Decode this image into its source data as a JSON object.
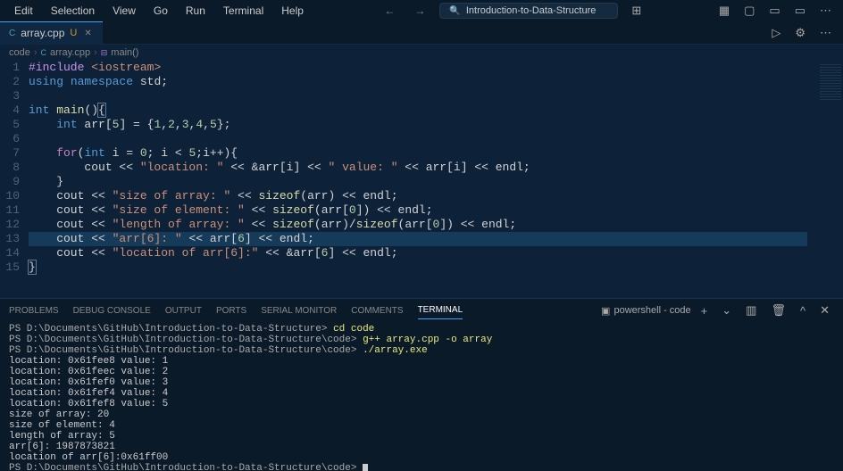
{
  "menu": {
    "edit": "Edit",
    "selection": "Selection",
    "view": "View",
    "go": "Go",
    "run": "Run",
    "terminal": "Terminal",
    "help": "Help"
  },
  "search": {
    "label": "Introduction-to-Data-Structure"
  },
  "tab": {
    "filename": "array.cpp",
    "status": "U"
  },
  "breadcrumb": {
    "p0": "code",
    "p1": "array.cpp",
    "p2": "main()"
  },
  "code": {
    "lines": [
      [
        {
          "c": "kw-inc",
          "t": "#include"
        },
        {
          "c": "",
          "t": " "
        },
        {
          "c": "str",
          "t": "<iostream>"
        }
      ],
      [
        {
          "c": "kw-using",
          "t": "using"
        },
        {
          "c": "",
          "t": " "
        },
        {
          "c": "kw",
          "t": "namespace"
        },
        {
          "c": "",
          "t": " std;"
        }
      ],
      [],
      [
        {
          "c": "kw-type",
          "t": "int"
        },
        {
          "c": "",
          "t": " "
        },
        {
          "c": "func",
          "t": "main"
        },
        {
          "c": "",
          "t": "()"
        },
        {
          "c": "brace-hl",
          "t": "{"
        }
      ],
      [
        {
          "c": "",
          "t": "    "
        },
        {
          "c": "kw-type",
          "t": "int"
        },
        {
          "c": "",
          "t": " arr["
        },
        {
          "c": "num",
          "t": "5"
        },
        {
          "c": "",
          "t": "] = {"
        },
        {
          "c": "num",
          "t": "1"
        },
        {
          "c": "",
          "t": ","
        },
        {
          "c": "num",
          "t": "2"
        },
        {
          "c": "",
          "t": ","
        },
        {
          "c": "num",
          "t": "3"
        },
        {
          "c": "",
          "t": ","
        },
        {
          "c": "num",
          "t": "4"
        },
        {
          "c": "",
          "t": ","
        },
        {
          "c": "num",
          "t": "5"
        },
        {
          "c": "",
          "t": "};"
        }
      ],
      [],
      [
        {
          "c": "",
          "t": "    "
        },
        {
          "c": "kw-for",
          "t": "for"
        },
        {
          "c": "",
          "t": "("
        },
        {
          "c": "kw-type",
          "t": "int"
        },
        {
          "c": "",
          "t": " i = "
        },
        {
          "c": "num",
          "t": "0"
        },
        {
          "c": "",
          "t": "; i < "
        },
        {
          "c": "num",
          "t": "5"
        },
        {
          "c": "",
          "t": ";i++){"
        }
      ],
      [
        {
          "c": "",
          "t": "        cout << "
        },
        {
          "c": "str",
          "t": "\"location: \""
        },
        {
          "c": "",
          "t": " << &arr[i] << "
        },
        {
          "c": "str",
          "t": "\" value: \""
        },
        {
          "c": "",
          "t": " << arr[i] << endl;"
        }
      ],
      [
        {
          "c": "",
          "t": "    }"
        }
      ],
      [
        {
          "c": "",
          "t": "    cout << "
        },
        {
          "c": "str",
          "t": "\"size of array: \""
        },
        {
          "c": "",
          "t": " << "
        },
        {
          "c": "func",
          "t": "sizeof"
        },
        {
          "c": "",
          "t": "(arr) << endl;"
        }
      ],
      [
        {
          "c": "",
          "t": "    cout << "
        },
        {
          "c": "str",
          "t": "\"size of element: \""
        },
        {
          "c": "",
          "t": " << "
        },
        {
          "c": "func",
          "t": "sizeof"
        },
        {
          "c": "",
          "t": "(arr["
        },
        {
          "c": "num",
          "t": "0"
        },
        {
          "c": "",
          "t": "]) << endl;"
        }
      ],
      [
        {
          "c": "",
          "t": "    cout << "
        },
        {
          "c": "str",
          "t": "\"length of array: \""
        },
        {
          "c": "",
          "t": " << "
        },
        {
          "c": "func",
          "t": "sizeof"
        },
        {
          "c": "",
          "t": "(arr)/"
        },
        {
          "c": "func",
          "t": "sizeof"
        },
        {
          "c": "",
          "t": "(arr["
        },
        {
          "c": "num",
          "t": "0"
        },
        {
          "c": "",
          "t": "]) << endl;"
        }
      ],
      [
        {
          "c": "",
          "t": "    cout << "
        },
        {
          "c": "str",
          "t": "\"arr[6]: \""
        },
        {
          "c": "",
          "t": " << arr["
        },
        {
          "c": "num",
          "t": "6"
        },
        {
          "c": "",
          "t": "] << endl;"
        }
      ],
      [
        {
          "c": "",
          "t": "    cout << "
        },
        {
          "c": "str",
          "t": "\"location of arr[6]:\""
        },
        {
          "c": "",
          "t": " << &arr["
        },
        {
          "c": "num",
          "t": "6"
        },
        {
          "c": "",
          "t": "] << endl;"
        }
      ],
      [
        {
          "c": "brace-hl",
          "t": "}"
        }
      ]
    ],
    "highlight_line": 13
  },
  "panel": {
    "tabs": {
      "problems": "PROBLEMS",
      "debug": "DEBUG CONSOLE",
      "output": "OUTPUT",
      "ports": "PORTS",
      "serial": "SERIAL MONITOR",
      "comments": "COMMENTS",
      "terminal": "TERMINAL"
    },
    "shell": "powershell - code"
  },
  "terminal": {
    "prompt": "PS D:\\Documents\\GitHub\\Introduction-to-Data-Structure",
    "prompt_code": "PS D:\\Documents\\GitHub\\Introduction-to-Data-Structure\\code>",
    "cmd1": "cd code",
    "cmd2": "g++ array.cpp -o array",
    "cmd3": "./array.exe",
    "out1": "location: 0x61fee8 value: 1",
    "out2": "location: 0x61feec value: 2",
    "out3": "location: 0x61fef0 value: 3",
    "out4": "location: 0x61fef4 value: 4",
    "out5": "location: 0x61fef8 value: 5",
    "out6": "size of array: 20",
    "out7": "size of element: 4",
    "out8": "length of array: 5",
    "out9": "arr[6]: 1987873821",
    "out10": "location of arr[6]:0x61ff00"
  }
}
